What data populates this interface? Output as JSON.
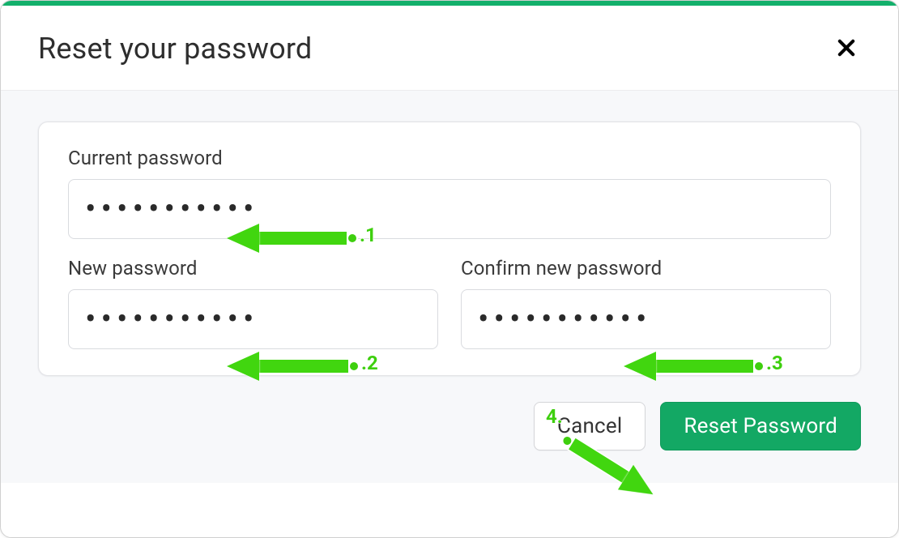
{
  "modal": {
    "title": "Reset your password",
    "close_icon": "close-icon"
  },
  "fields": {
    "current": {
      "label": "Current password",
      "value": "•••••••••••"
    },
    "new": {
      "label": "New password",
      "value": "•••••••••••"
    },
    "confirm": {
      "label": "Confirm new password",
      "value": "•••••••••••"
    }
  },
  "buttons": {
    "cancel": "Cancel",
    "reset": "Reset Password"
  },
  "annotations": {
    "a1": ".1",
    "a2": ".2",
    "a3": ".3",
    "a4": "4."
  },
  "colors": {
    "accent_green": "#13a864",
    "arrow_green": "#41d60f"
  }
}
